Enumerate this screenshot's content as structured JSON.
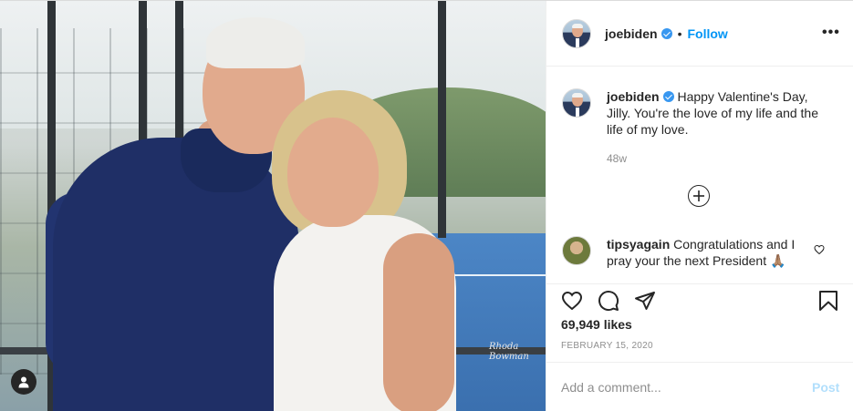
{
  "post": {
    "username": "joebiden",
    "follow_label": "Follow",
    "dot": "•",
    "more_label": "•••",
    "photo_watermark": "Rhoda Bowman",
    "caption_text": "Happy Valentine's Day, Jilly. You're the love of my life and the life of my love.",
    "caption_time": "48w",
    "comments": [
      {
        "username": "tipsyagain",
        "text": "Congratulations and I pray your the next President 🙏🏽"
      }
    ],
    "likes_text": "69,949 likes",
    "date_text": "FEBRUARY 15, 2020",
    "add_comment_placeholder": "Add a comment...",
    "post_label": "Post"
  },
  "icons": {
    "verified": "verified-badge-icon",
    "more": "more-options-icon",
    "load_more": "load-more-comments-icon",
    "comment_like": "heart-icon",
    "like": "heart-icon",
    "comment": "comment-icon",
    "share": "share-icon",
    "save": "bookmark-icon",
    "tagged_user": "user-icon"
  },
  "colors": {
    "accent": "#0095f6",
    "verified": "#3897f0",
    "post_disabled": "#b2dffc",
    "muted": "#8e8e8e"
  }
}
